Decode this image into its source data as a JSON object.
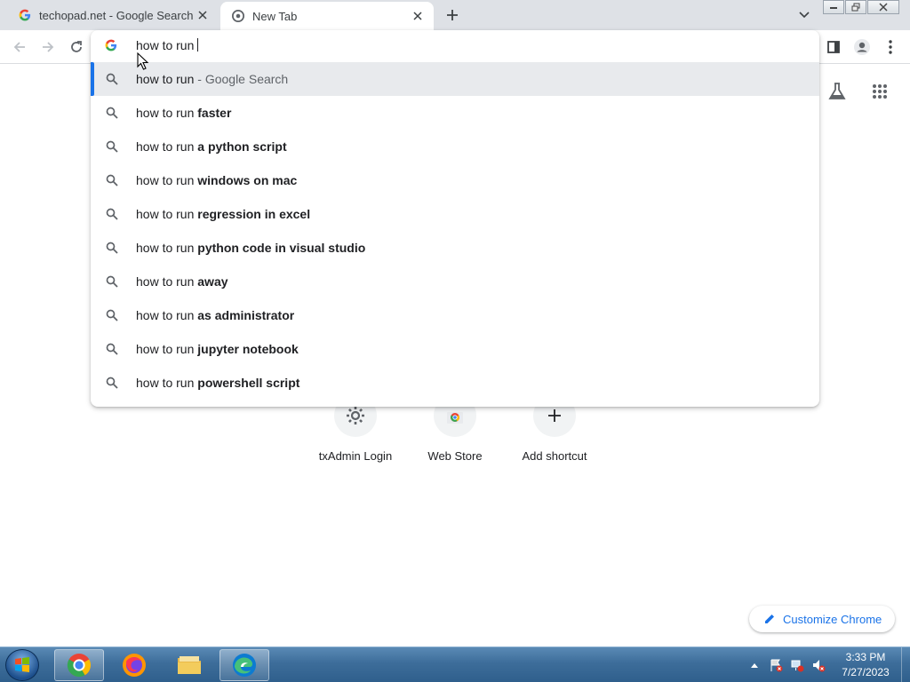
{
  "tabs": [
    {
      "title": "techopad.net - Google Search",
      "icon": "google-g-icon",
      "active": false
    },
    {
      "title": "New Tab",
      "icon": "chrome-icon",
      "active": true
    }
  ],
  "omnibox": {
    "query": "how to run",
    "suggestions": [
      {
        "prefix": "how to run",
        "bold": "",
        "suffix": " - Google Search",
        "selected": true
      },
      {
        "prefix": "how to run ",
        "bold": "faster",
        "suffix": "",
        "selected": false
      },
      {
        "prefix": "how to run ",
        "bold": "a python script",
        "suffix": "",
        "selected": false
      },
      {
        "prefix": "how to run ",
        "bold": "windows on mac",
        "suffix": "",
        "selected": false
      },
      {
        "prefix": "how to run ",
        "bold": "regression in excel",
        "suffix": "",
        "selected": false
      },
      {
        "prefix": "how to run ",
        "bold": "python code in visual studio",
        "suffix": "",
        "selected": false
      },
      {
        "prefix": "how to run ",
        "bold": "away",
        "suffix": "",
        "selected": false
      },
      {
        "prefix": "how to run ",
        "bold": "as administrator",
        "suffix": "",
        "selected": false
      },
      {
        "prefix": "how to run ",
        "bold": "jupyter notebook",
        "suffix": "",
        "selected": false
      },
      {
        "prefix": "how to run ",
        "bold": "powershell script",
        "suffix": "",
        "selected": false
      }
    ]
  },
  "shortcuts": [
    {
      "label": "txAdmin Login",
      "icon": "gear-icon"
    },
    {
      "label": "Web Store",
      "icon": "web-store-icon"
    },
    {
      "label": "Add shortcut",
      "icon": "plus-icon"
    }
  ],
  "customize": {
    "label": "Customize Chrome"
  },
  "taskbar": {
    "apps": [
      "chrome-icon",
      "firefox-icon",
      "file-explorer-icon",
      "edge-icon"
    ],
    "clock_time": "3:33 PM",
    "clock_date": "7/27/2023"
  },
  "colors": {
    "accent": "#1a73e8",
    "tabstrip": "#dee1e6",
    "selected_row": "#e8eaed"
  }
}
